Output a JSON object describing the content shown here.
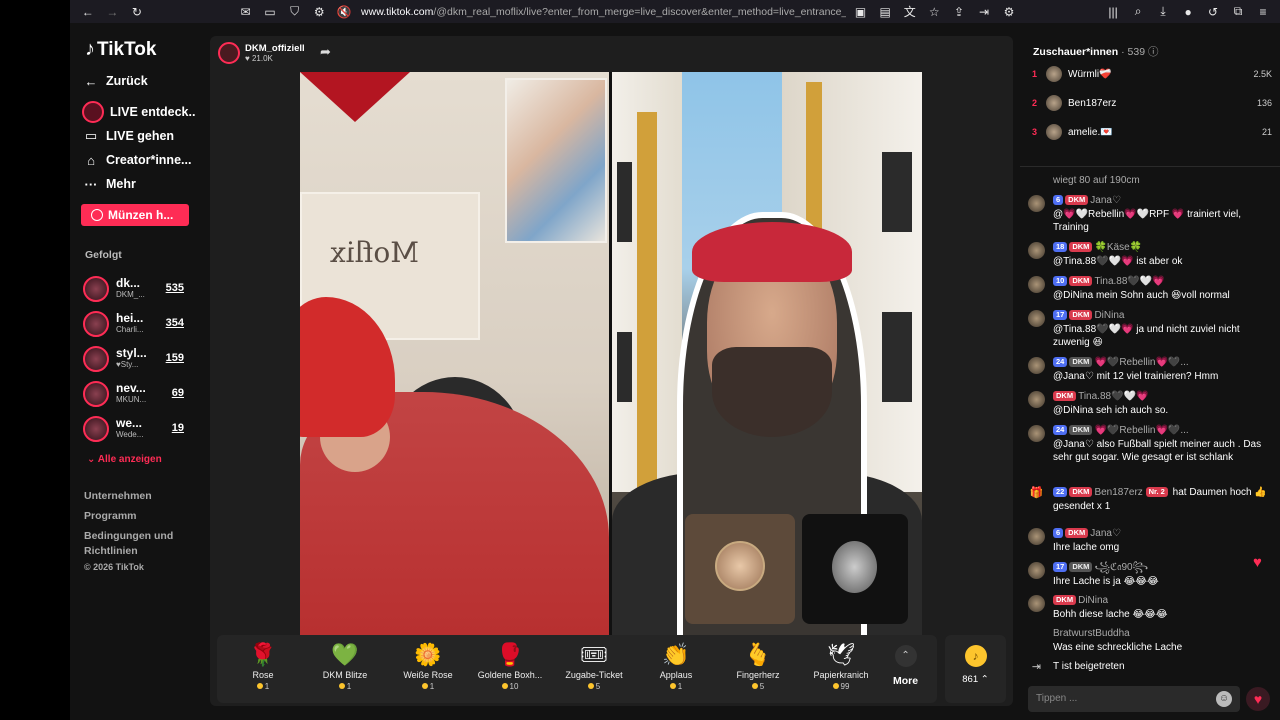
{
  "browser": {
    "url_main": "www.tiktok.com",
    "url_rest": "/@dkm_real_moflix/live?enter_from_merge=live_discover&enter_method=live_entrance_hover_la"
  },
  "sidebar": {
    "brand": "TikTok",
    "back": "Zurück",
    "nav": [
      {
        "label": "LIVE entdeck.."
      },
      {
        "label": "LIVE gehen"
      },
      {
        "label": "Creator*inne..."
      },
      {
        "label": "Mehr"
      }
    ],
    "coins_button": "Münzen h...",
    "followed_title": "Gefolgt",
    "followed": [
      {
        "name": "dk...",
        "sub": "DKM_...",
        "count": "535"
      },
      {
        "name": "hei...",
        "sub": "Charli...",
        "count": "354"
      },
      {
        "name": "styl...",
        "sub": "♥Sty...",
        "count": "159"
      },
      {
        "name": "nev...",
        "sub": "MKUN...",
        "count": "69"
      },
      {
        "name": "we...",
        "sub": "Wede...",
        "count": "19"
      }
    ],
    "show_all": "Alle anzeigen",
    "footer": [
      "Unternehmen",
      "Programm",
      "Bedingungen und",
      "Richtlinien"
    ],
    "copyright": "© 2026 TikTok"
  },
  "stream": {
    "host_name": "DKM_offiziell",
    "likes": "21.0K",
    "canvas_text": "Moflix"
  },
  "gifts": [
    {
      "icon": "🌹",
      "name": "Rose",
      "price": "1"
    },
    {
      "icon": "💚",
      "name": "DKM Blitze",
      "price": "1"
    },
    {
      "icon": "🌼",
      "name": "Weiße Rose",
      "price": "1"
    },
    {
      "icon": "🥊",
      "name": "Goldene Boxh...",
      "price": "10"
    },
    {
      "icon": "🎟",
      "name": "Zugabe-Ticket",
      "price": "5"
    },
    {
      "icon": "👏",
      "name": "Applaus",
      "price": "1"
    },
    {
      "icon": "🫰",
      "name": "Fingerherz",
      "price": "5"
    },
    {
      "icon": "🕊",
      "name": "Papierkranich",
      "price": "99"
    }
  ],
  "more_label": "More",
  "coins_balance": "861",
  "viewers": {
    "title": "Zuschauer*innen",
    "count": "· 539",
    "top": [
      {
        "rank": "1",
        "name": "Würmli❤️‍🩹",
        "score": "2.5K"
      },
      {
        "rank": "2",
        "name": "Ben187erz",
        "score": "136"
      },
      {
        "rank": "3",
        "name": "amelie.💌",
        "score": "21"
      }
    ]
  },
  "chat": [
    {
      "badges": [],
      "user": "",
      "msg": "wiegt 80 auf 190cm"
    },
    {
      "badges": [
        "6",
        "DKM"
      ],
      "user": "Jana♡",
      "msg": "@💗🤍Rebellin💗🤍RPF 💗 trainiert viel, Training"
    },
    {
      "badges": [
        "18",
        "DKM"
      ],
      "user": "🍀Käse🍀",
      "msg": "@Tina.88🖤🤍💗 ist aber ok"
    },
    {
      "badges": [
        "10",
        "DKM"
      ],
      "user": "Tina.88🖤🤍💗",
      "msg": "@DiNina mein Sohn auch 😆voll normal"
    },
    {
      "badges": [
        "17",
        "DKM"
      ],
      "user": "DiNina",
      "msg": "@Tina.88🖤🤍💗 ja und nicht zuviel nicht zuwenig 😆"
    },
    {
      "badges": [
        "24",
        "DKM"
      ],
      "user": "💗🖤Rebellin💗🖤...",
      "msg": "@Jana♡ mit 12 viel trainieren? Hmm"
    },
    {
      "badges": [
        "DKM"
      ],
      "user": "Tina.88🖤🤍💗",
      "msg": "@DiNina seh ich auch so."
    },
    {
      "badges": [
        "24",
        "DKM"
      ],
      "user": "💗🖤Rebellin💗🖤...",
      "msg": "@Jana♡ also Fußball spielt meiner auch . Das sehr gut sogar. Wie gesagt er ist schlank"
    },
    {
      "badges": [
        "22",
        "DKM"
      ],
      "user": "Ben187erz",
      "nr": "Nr. 2",
      "msg": "hat Daumen hoch 👍 gesendet x 1"
    },
    {
      "badges": [
        "6",
        "DKM"
      ],
      "user": "Jana♡",
      "msg": "Ihre lache omg"
    },
    {
      "badges": [
        "17",
        "DKM"
      ],
      "user": "꧁ℭ𝔞90꧂",
      "msg": "Ihre Lache is ja 😂😂😂"
    },
    {
      "badges": [
        "DKM"
      ],
      "user": "DiNina",
      "msg": "Bohh diese lache 😂😂😂"
    },
    {
      "badges": [],
      "user": "BratwurstBuddha",
      "msg": "Was eine schreckliche Lache"
    },
    {
      "badges": [],
      "user": "T",
      "msg": "ist beigetreten"
    }
  ],
  "chat_placeholder": "Tippen ...",
  "colors": {
    "accent": "#fe2c55",
    "background": "#121212",
    "coin": "#fdc52d"
  }
}
